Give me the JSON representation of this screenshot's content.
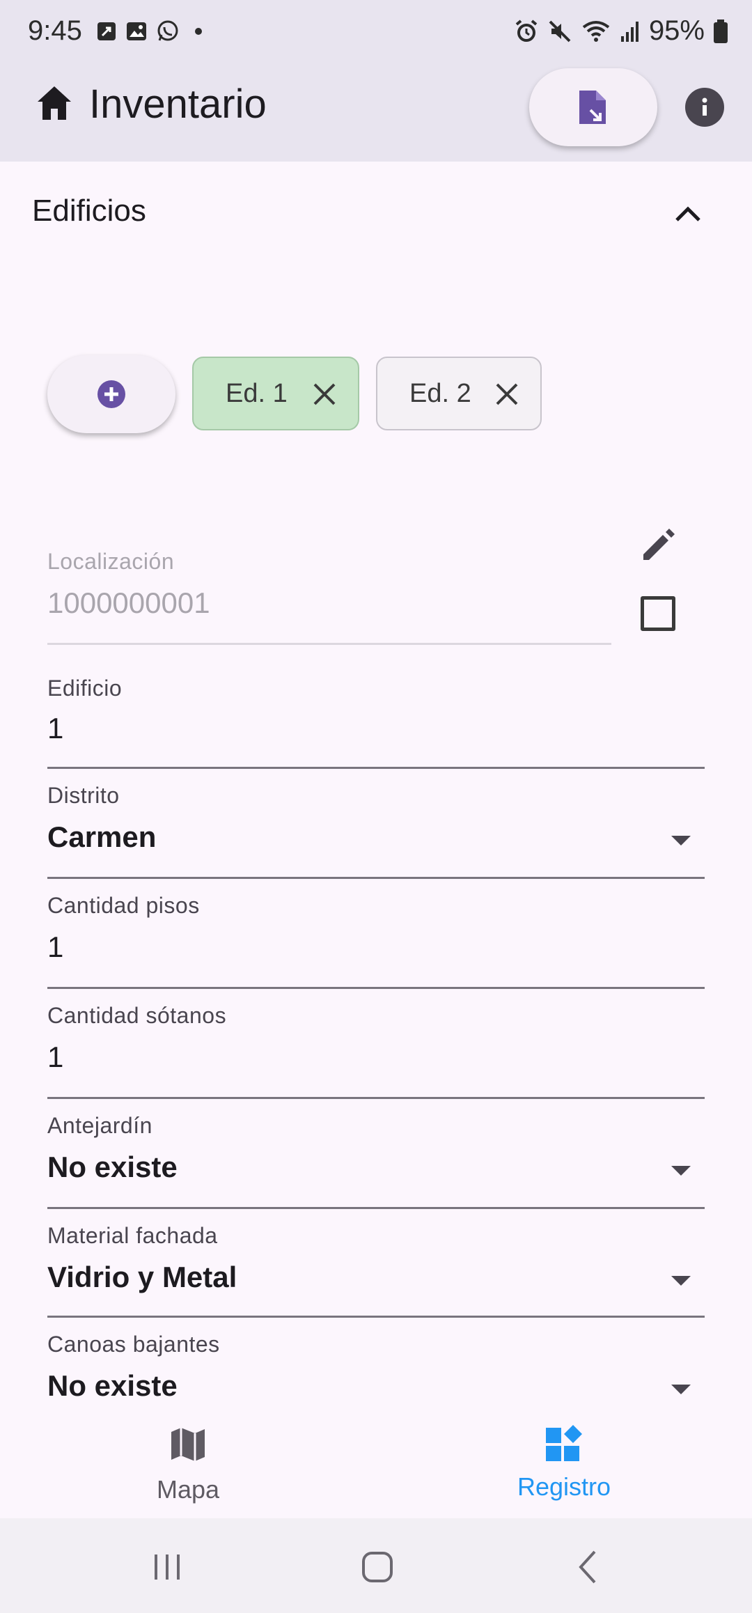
{
  "status_bar": {
    "time": "9:45",
    "battery_text": "95%"
  },
  "app_bar": {
    "title": "Inventario",
    "icons": {
      "home": "home-icon",
      "export": "file-export-icon",
      "info": "info-icon"
    }
  },
  "section": {
    "title": "Edificios",
    "expanded": true
  },
  "chips": {
    "add_icon": "add-circle-icon",
    "items": [
      {
        "label": "Ed. 1",
        "selected": true
      },
      {
        "label": "Ed. 2",
        "selected": false
      }
    ]
  },
  "form": {
    "localizacion": {
      "label": "Localización",
      "value": "1000000001"
    },
    "edificio": {
      "label": "Edificio",
      "value": "1"
    },
    "distrito": {
      "label": "Distrito",
      "value": "Carmen"
    },
    "cantidad_pisos": {
      "label": "Cantidad pisos",
      "value": "1"
    },
    "cantidad_sotanos": {
      "label": "Cantidad sótanos",
      "value": "1"
    },
    "antejardin": {
      "label": "Antejardín",
      "value": "No existe"
    },
    "material_fachada": {
      "label": "Material fachada",
      "value": "Vidrio y Metal"
    },
    "canoas_bajantes": {
      "label": "Canoas bajantes",
      "value": "No existe"
    }
  },
  "bottom_nav": {
    "items": [
      {
        "label": "Mapa",
        "icon": "map-icon",
        "active": false
      },
      {
        "label": "Registro",
        "icon": "dashboard-icon",
        "active": true
      }
    ]
  },
  "colors": {
    "accent": "#6750a4",
    "active_nav": "#2196f3",
    "selected_chip": "#c8e6c9",
    "background": "#fcf6fd",
    "app_bar": "#e8e4ef"
  }
}
